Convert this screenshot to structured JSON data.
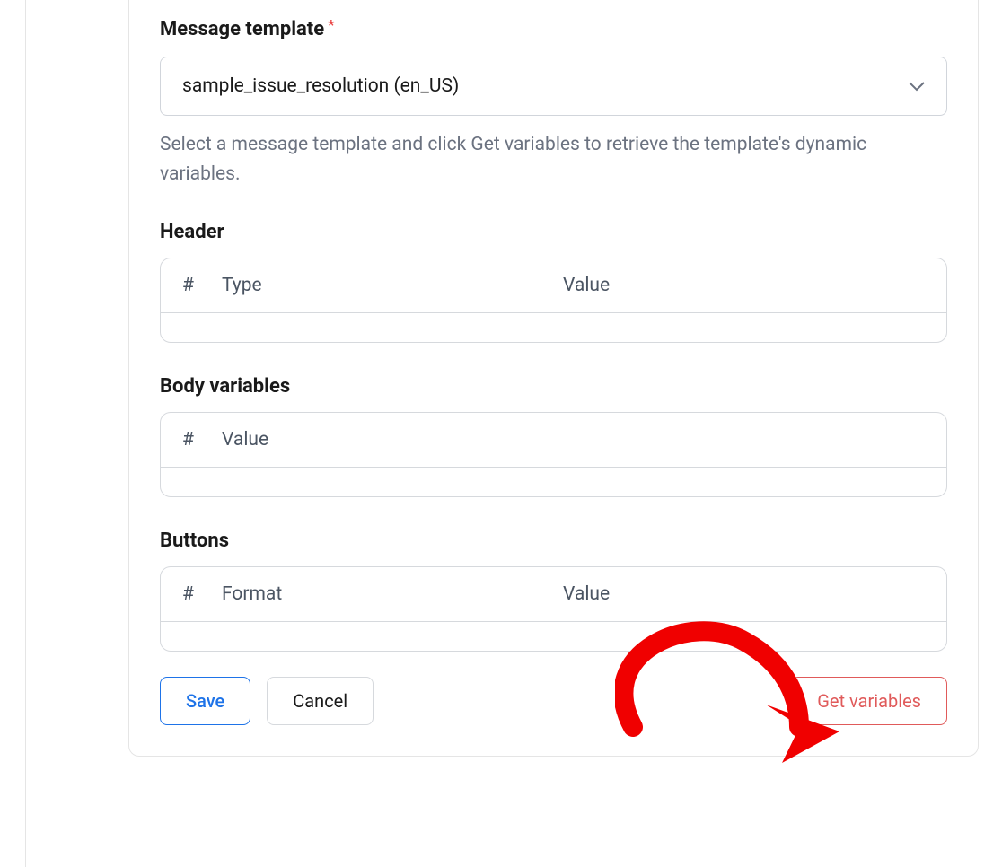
{
  "template_section": {
    "label": "Message template",
    "required_marker": "*",
    "select_value": "sample_issue_resolution (en_US)",
    "help_text": "Select a message template and click Get variables to retrieve the template's dynamic variables."
  },
  "sections": {
    "header": {
      "title": "Header",
      "columns": {
        "hash": "#",
        "a": "Type",
        "b": "Value"
      }
    },
    "body_variables": {
      "title": "Body variables",
      "columns": {
        "hash": "#",
        "a": "Value"
      }
    },
    "buttons": {
      "title": "Buttons",
      "columns": {
        "hash": "#",
        "a": "Format",
        "b": "Value"
      }
    }
  },
  "actions": {
    "save": "Save",
    "cancel": "Cancel",
    "get_variables": "Get variables"
  }
}
